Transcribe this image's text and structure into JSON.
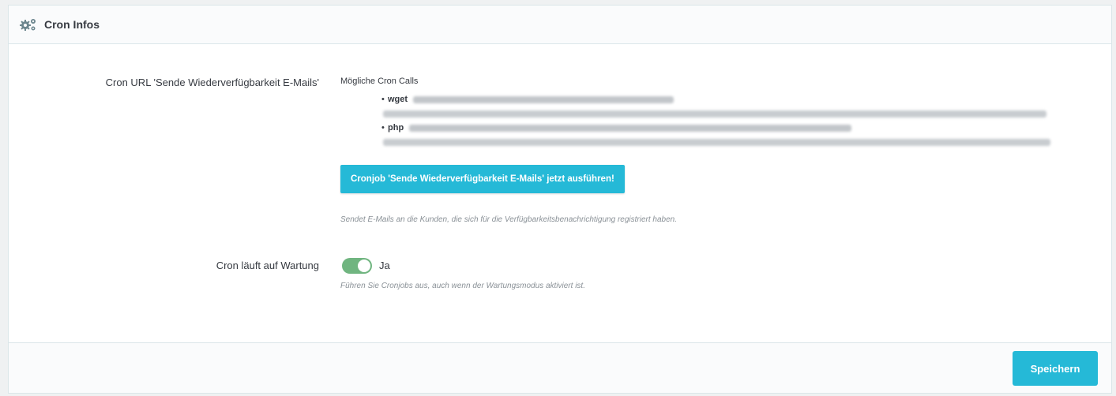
{
  "panel": {
    "title": "Cron Infos",
    "icon": "gears-icon"
  },
  "cron_url": {
    "label": "Cron URL 'Sende Wiederverfügbarkeit E-Mails'",
    "calls_title": "Mögliche Cron Calls",
    "calls": [
      {
        "command": "wget"
      },
      {
        "command": "php"
      }
    ],
    "run_button": "Cronjob 'Sende Wiederverfügbarkeit E-Mails' jetzt ausführen!",
    "help": "Sendet E-Mails an die Kunden, die sich für die Verfügbarkeitsbenachrichtigung registriert haben."
  },
  "maintenance": {
    "label": "Cron läuft auf Wartung",
    "toggle_on": true,
    "toggle_label": "Ja",
    "help": "Führen Sie Cronjobs aus, auch wenn der Wartungsmodus aktiviert ist."
  },
  "footer": {
    "save_label": "Speichern"
  },
  "colors": {
    "accent": "#25b9d7",
    "toggle_on": "#70b580"
  }
}
